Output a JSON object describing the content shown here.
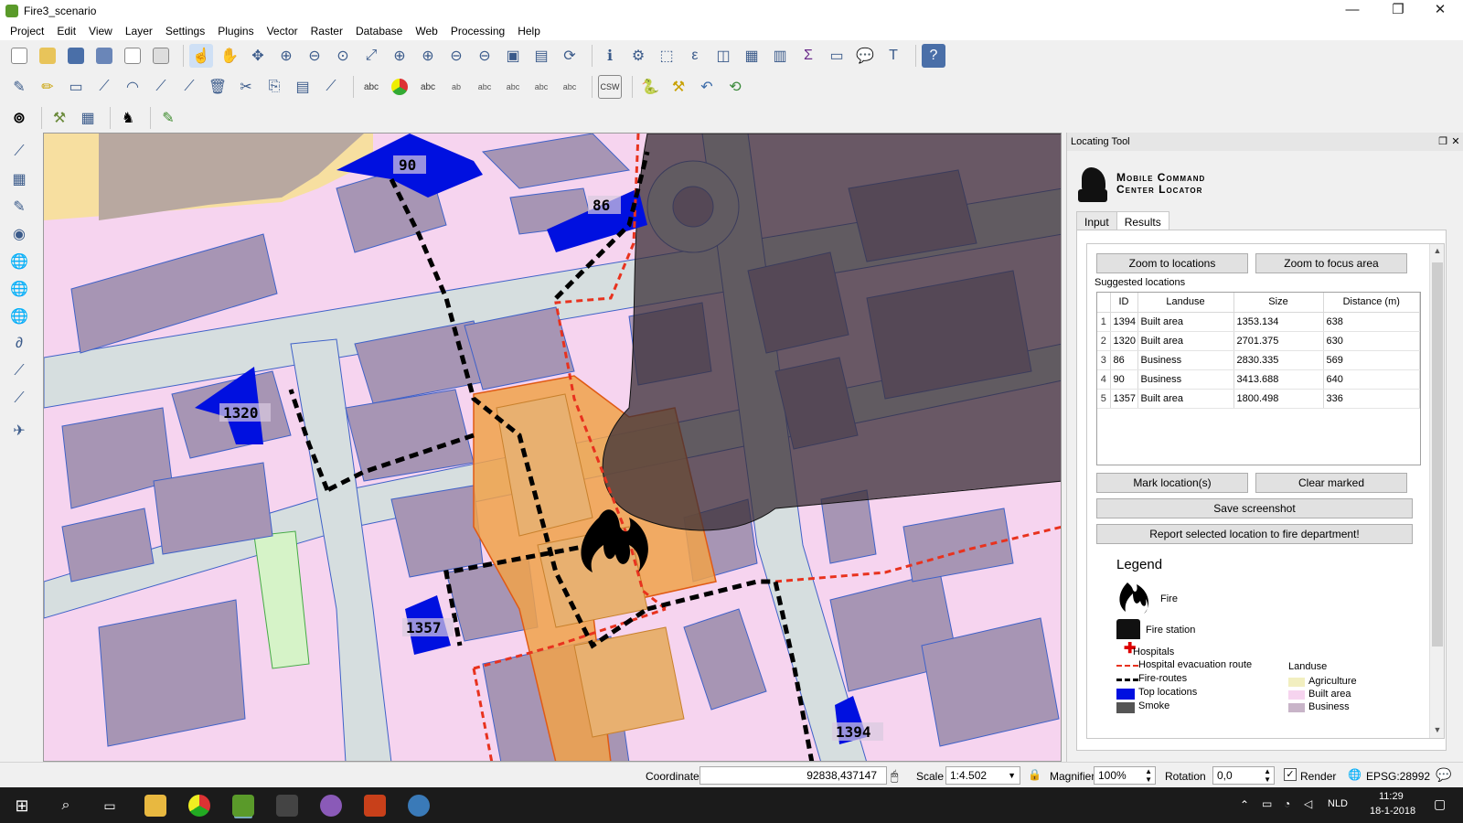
{
  "window": {
    "title": "Fire3_scenario",
    "minimize": "—",
    "maximize": "❐",
    "close": "✕"
  },
  "menu": [
    "Project",
    "Edit",
    "View",
    "Layer",
    "Settings",
    "Plugins",
    "Vector",
    "Raster",
    "Database",
    "Web",
    "Processing",
    "Help"
  ],
  "map": {
    "labels": {
      "parcel_90": "90",
      "parcel_86": "86",
      "parcel_1320": "1320",
      "parcel_1357": "1357",
      "parcel_1394": "1394"
    },
    "colors": {
      "built_area": "#f6d4ef",
      "building": "#a795b4",
      "road": "#d6dedf",
      "road_edge": "#3f61c8",
      "agriculture": "#f7dfa0",
      "top_location": "#0010e0",
      "fire_zone": "#f0a24a",
      "smoke": "#3a2f37",
      "fire_route": "#000000",
      "evacuation_route": "#e8321e"
    }
  },
  "panel": {
    "title": "Locating Tool",
    "logo_line1": "Mobile Command",
    "logo_line2": "Center Locator",
    "tabs": [
      "Input",
      "Results"
    ],
    "active_tab": "Results",
    "zoom_locations": "Zoom to locations",
    "zoom_focus": "Zoom to focus area",
    "suggested": "Suggested locations",
    "columns": [
      "ID",
      "Landuse",
      "Size",
      "Distance (m)"
    ],
    "rows": [
      {
        "n": "1",
        "id": "1394",
        "landuse": "Built area",
        "size": "1353.134",
        "dist": "638"
      },
      {
        "n": "2",
        "id": "1320",
        "landuse": "Built area",
        "size": "2701.375",
        "dist": "630"
      },
      {
        "n": "3",
        "id": "86",
        "landuse": "Business",
        "size": "2830.335",
        "dist": "569"
      },
      {
        "n": "4",
        "id": "90",
        "landuse": "Business",
        "size": "3413.688",
        "dist": "640"
      },
      {
        "n": "5",
        "id": "1357",
        "landuse": "Built area",
        "size": "1800.498",
        "dist": "336"
      }
    ],
    "mark": "Mark location(s)",
    "clear": "Clear marked",
    "screenshot": "Save screenshot",
    "report": "Report selected location to fire department!",
    "legend": {
      "title": "Legend",
      "fire": "Fire",
      "station": "Fire station",
      "hospitals": "Hospitals",
      "evac": "Hospital evacuation route",
      "routes": "Fire-routes",
      "top": "Top locations",
      "smoke": "Smoke",
      "landuse": "Landuse",
      "agri": "Agriculture",
      "built": "Built area",
      "business": "Business"
    }
  },
  "status": {
    "coord_label": "Coordinate",
    "coord": "92838,437147",
    "scale_label": "Scale",
    "scale": "1:4.502",
    "magnifier_label": "Magnifier",
    "magnifier": "100%",
    "rotation_label": "Rotation",
    "rotation": "0,0",
    "render": "Render",
    "epsg": "EPSG:28992"
  },
  "taskbar": {
    "lang": "NLD",
    "time": "11:29",
    "date": "18-1-2018"
  }
}
